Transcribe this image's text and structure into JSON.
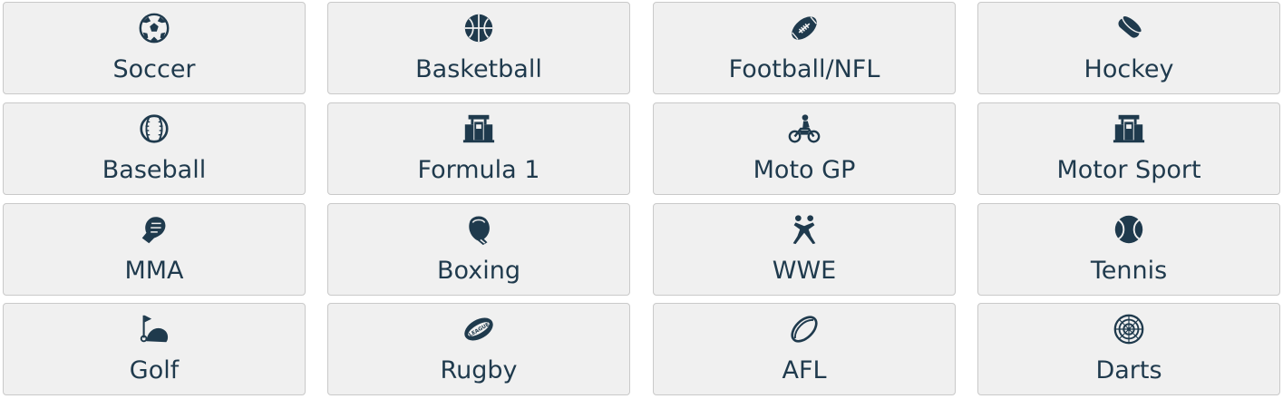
{
  "sports": [
    {
      "label": "Soccer",
      "icon": "soccer-ball-icon"
    },
    {
      "label": "Basketball",
      "icon": "basketball-icon"
    },
    {
      "label": "Football/NFL",
      "icon": "american-football-icon"
    },
    {
      "label": "Hockey",
      "icon": "hockey-puck-icon"
    },
    {
      "label": "Baseball",
      "icon": "baseball-icon"
    },
    {
      "label": "Formula 1",
      "icon": "race-car-icon"
    },
    {
      "label": "Moto GP",
      "icon": "motorcycle-icon"
    },
    {
      "label": "Motor Sport",
      "icon": "race-car-icon"
    },
    {
      "label": "MMA",
      "icon": "mma-glove-icon"
    },
    {
      "label": "Boxing",
      "icon": "boxing-glove-icon"
    },
    {
      "label": "WWE",
      "icon": "wrestlers-icon"
    },
    {
      "label": "Tennis",
      "icon": "tennis-ball-icon"
    },
    {
      "label": "Golf",
      "icon": "golf-flag-icon"
    },
    {
      "label": "Rugby",
      "icon": "rugby-league-ball-icon"
    },
    {
      "label": "AFL",
      "icon": "afl-ball-icon"
    },
    {
      "label": "Darts",
      "icon": "dartboard-icon"
    }
  ],
  "colors": {
    "icon": "#1f3a4d",
    "text": "#1f3a4d",
    "tile_bg": "#f0f0f0",
    "tile_border": "#c9c9c9"
  }
}
